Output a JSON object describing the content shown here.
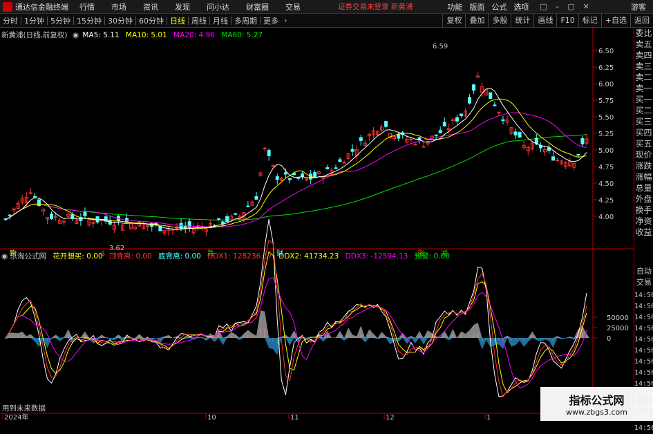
{
  "menubar": {
    "app_title": "通达信金融终端",
    "items": [
      "行情",
      "市场",
      "资讯",
      "发现",
      "问小达",
      "财富圈",
      "交易"
    ],
    "login_status": "证券交易未登录  新黄浦",
    "right_items": [
      "功能",
      "版面",
      "公式",
      "选项"
    ],
    "window_buttons": [
      "□",
      "–",
      "▢",
      "✕"
    ],
    "guest": "游客"
  },
  "toolbar": {
    "periods": [
      "分时",
      "1分钟",
      "5分钟",
      "15分钟",
      "30分钟",
      "60分钟",
      "日线",
      "周线",
      "月线",
      "多周期",
      "更多"
    ],
    "active_period": "日线",
    "right_buttons": [
      "复权",
      "叠加",
      "多股",
      "统计",
      "画线",
      "F10",
      "标记",
      "+自选",
      "返回"
    ]
  },
  "main_chart": {
    "stock_title": "新黄浦(日线,前复权)",
    "ma5": "MA5: 5.11",
    "ma10": "MA10: 5.01",
    "ma20": "MA20: 4.96",
    "ma60": "MA60: 5.27",
    "high_label": "6.59",
    "low_label": "3.62",
    "price_ticks": [
      "6.50",
      "6.25",
      "6.00",
      "5.75",
      "5.50",
      "5.25",
      "5.00",
      "4.75",
      "4.50",
      "4.25",
      "4.00"
    ],
    "markers": [
      "购",
      "$",
      "跌",
      "财",
      "涨",
      "减"
    ],
    "colors": {
      "up": "#ff3232",
      "down": "#54ffff",
      "ma5": "#ffffff",
      "ma10": "#ffff00",
      "ma20": "#ff00ff",
      "ma60": "#00e000"
    }
  },
  "sub_chart": {
    "name": "乐淘公式网",
    "items": [
      {
        "label": "花开想买: 0.00",
        "color": "#ffff00"
      },
      {
        "label": "顶背离: 0.00",
        "color": "#ff3232"
      },
      {
        "label": "底背离: 0.00",
        "color": "#54ffff"
      },
      {
        "label": "DDX1: 128236.17",
        "color": "#ff3232"
      },
      {
        "label": "DDX2: 41734.23",
        "color": "#ffff00"
      },
      {
        "label": "DDX3: -12594.13",
        "color": "#ff00ff"
      },
      {
        "label": "预警: 0.00",
        "color": "#00e000"
      }
    ],
    "ticks": [
      "50000",
      "25000",
      "0"
    ],
    "footer_text": "用到未来数据"
  },
  "x_axis": {
    "labels": [
      "2024年",
      "10",
      "11",
      "12",
      "1"
    ]
  },
  "side_panel": {
    "items": [
      "委比",
      "卖五",
      "卖四",
      "卖三",
      "卖二",
      "卖一",
      "买一",
      "买二",
      "买三",
      "买四",
      "买五",
      "现价",
      "涨跌",
      "涨幅",
      "总量",
      "外盘",
      "换手",
      "净资",
      "收益"
    ],
    "sub_items": [
      "自动",
      "交易"
    ],
    "times": [
      "14:56",
      "14:56",
      "14:56",
      "14:56",
      "14:56",
      "14:56",
      "14:56",
      "14:56",
      "14:56",
      "14:56",
      "14:56",
      "14:56",
      "14:56"
    ]
  },
  "watermark": {
    "title": "指标公式网",
    "url": "www.zbgs3.com"
  }
}
